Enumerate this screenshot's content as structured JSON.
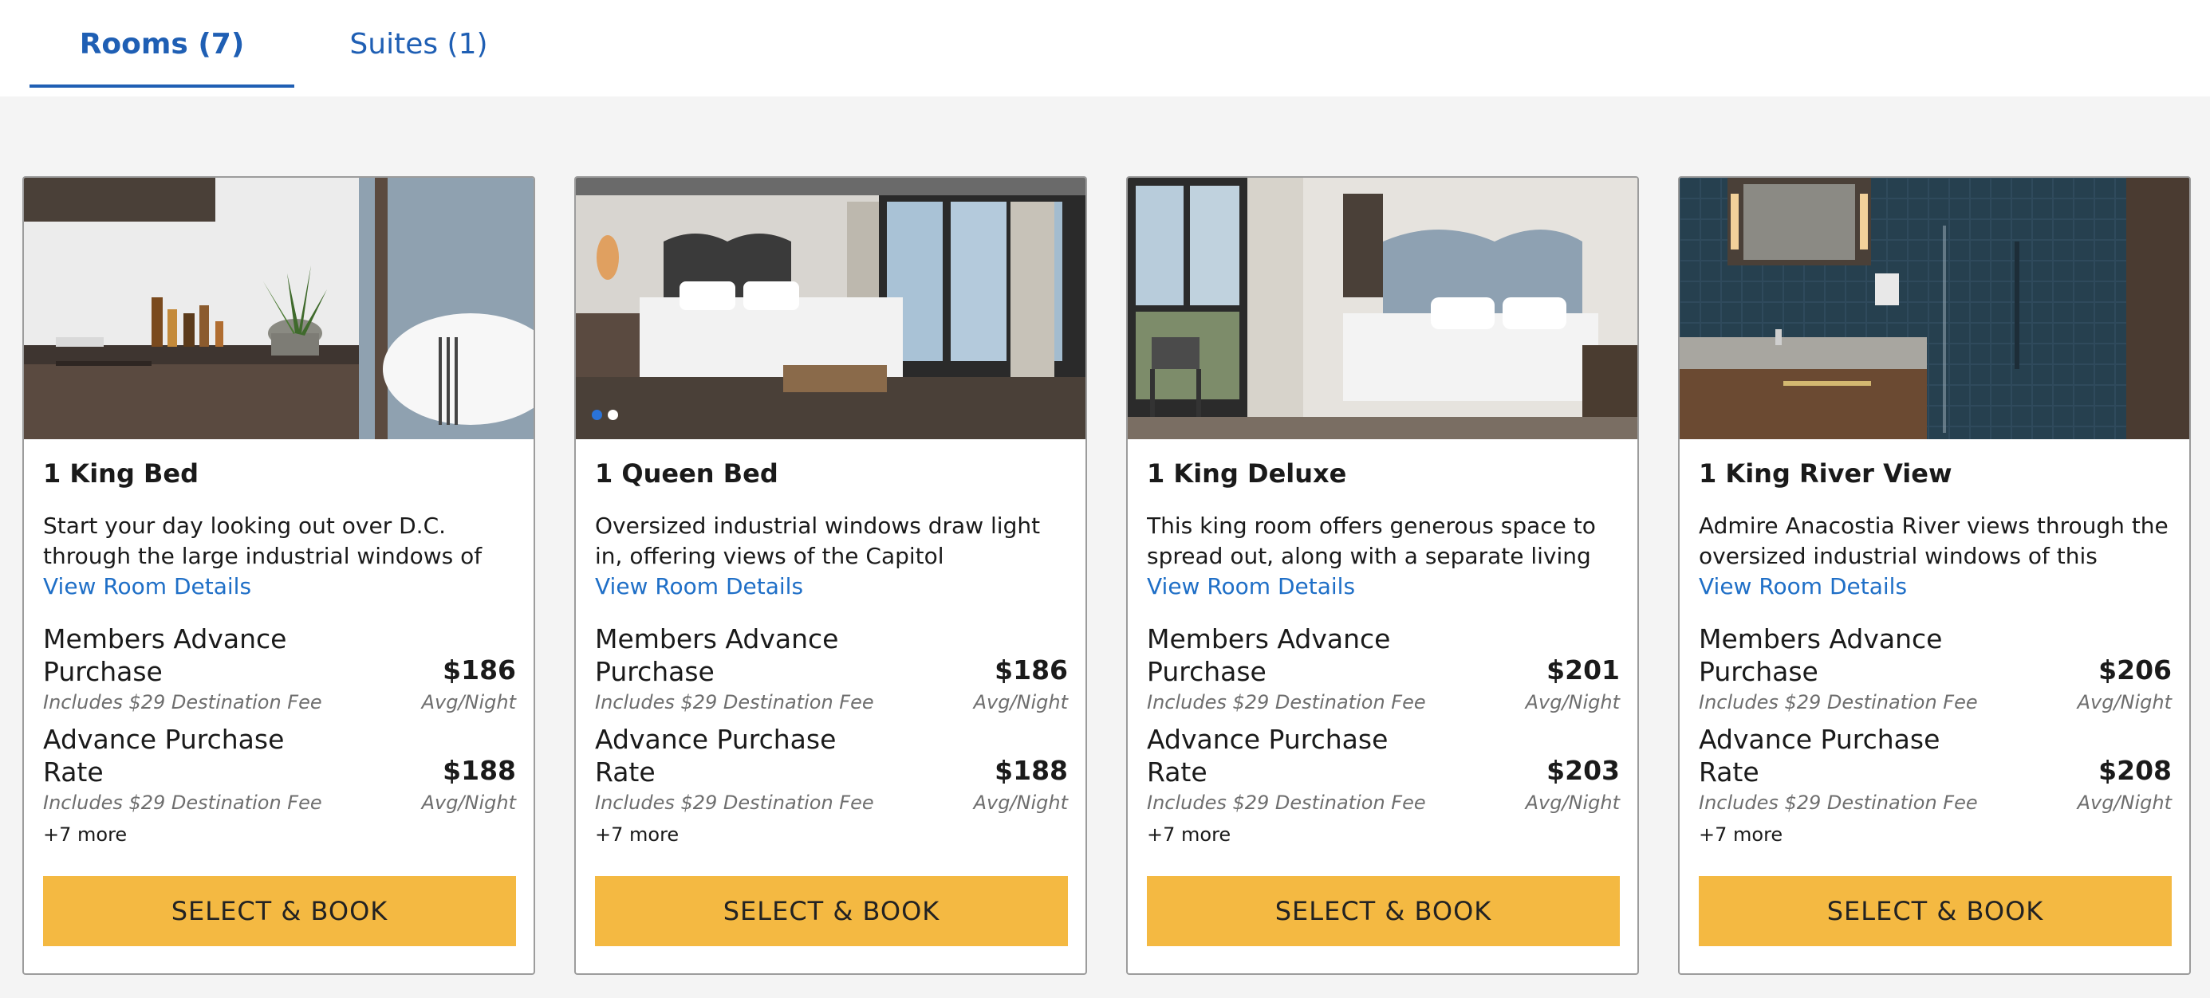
{
  "tabs": [
    {
      "label": "Rooms (7)",
      "active": true
    },
    {
      "label": "Suites (1)",
      "active": false
    }
  ],
  "colors": {
    "accent": "#1f5fb4",
    "link": "#1f6fc7",
    "button": "#f4b942",
    "page_background": "#f4f4f4"
  },
  "rooms": [
    {
      "image_alt": "Bar cart with bottles, potted plant and bed pillow",
      "title": "1 King Bed",
      "description": "Start your day looking out over D.C. through the large industrial windows of this stylish,...",
      "details_link": "View Room Details",
      "rates": [
        {
          "name": "Members Advance Purchase",
          "price": "$186",
          "fee": "Includes $29 Destination Fee",
          "unit": "Avg/Night"
        },
        {
          "name": "Advance Purchase Rate",
          "price": "$188",
          "fee": "Includes $29 Destination Fee",
          "unit": "Avg/Night"
        }
      ],
      "more": "+7 more",
      "button": "SELECT & BOOK"
    },
    {
      "image_alt": "Queen bed with bench and large industrial window",
      "title": "1 Queen Bed",
      "description": "Oversized industrial windows draw light in, offering views of the Capitol Riverfront...",
      "details_link": "View Room Details",
      "rates": [
        {
          "name": "Members Advance Purchase",
          "price": "$186",
          "fee": "Includes $29 Destination Fee",
          "unit": "Avg/Night"
        },
        {
          "name": "Advance Purchase Rate",
          "price": "$188",
          "fee": "Includes $29 Destination Fee",
          "unit": "Avg/Night"
        }
      ],
      "more": "+7 more",
      "button": "SELECT & BOOK"
    },
    {
      "image_alt": "King bed with city view window and chair",
      "title": "1 King Deluxe",
      "description": "This king room offers generous space to spread out, along with a separate living are...",
      "details_link": "View Room Details",
      "rates": [
        {
          "name": "Members Advance Purchase",
          "price": "$201",
          "fee": "Includes $29 Destination Fee",
          "unit": "Avg/Night"
        },
        {
          "name": "Advance Purchase Rate",
          "price": "$203",
          "fee": "Includes $29 Destination Fee",
          "unit": "Avg/Night"
        }
      ],
      "more": "+7 more",
      "button": "SELECT & BOOK"
    },
    {
      "image_alt": "Bathroom with blue tiled shower and vanity",
      "title": "1 King River View",
      "description": "Admire Anacostia River views through the oversized industrial windows of this spacio...",
      "details_link": "View Room Details",
      "rates": [
        {
          "name": "Members Advance Purchase",
          "price": "$206",
          "fee": "Includes $29 Destination Fee",
          "unit": "Avg/Night"
        },
        {
          "name": "Advance Purchase Rate",
          "price": "$208",
          "fee": "Includes $29 Destination Fee",
          "unit": "Avg/Night"
        }
      ],
      "more": "+7 more",
      "button": "SELECT & BOOK"
    }
  ]
}
